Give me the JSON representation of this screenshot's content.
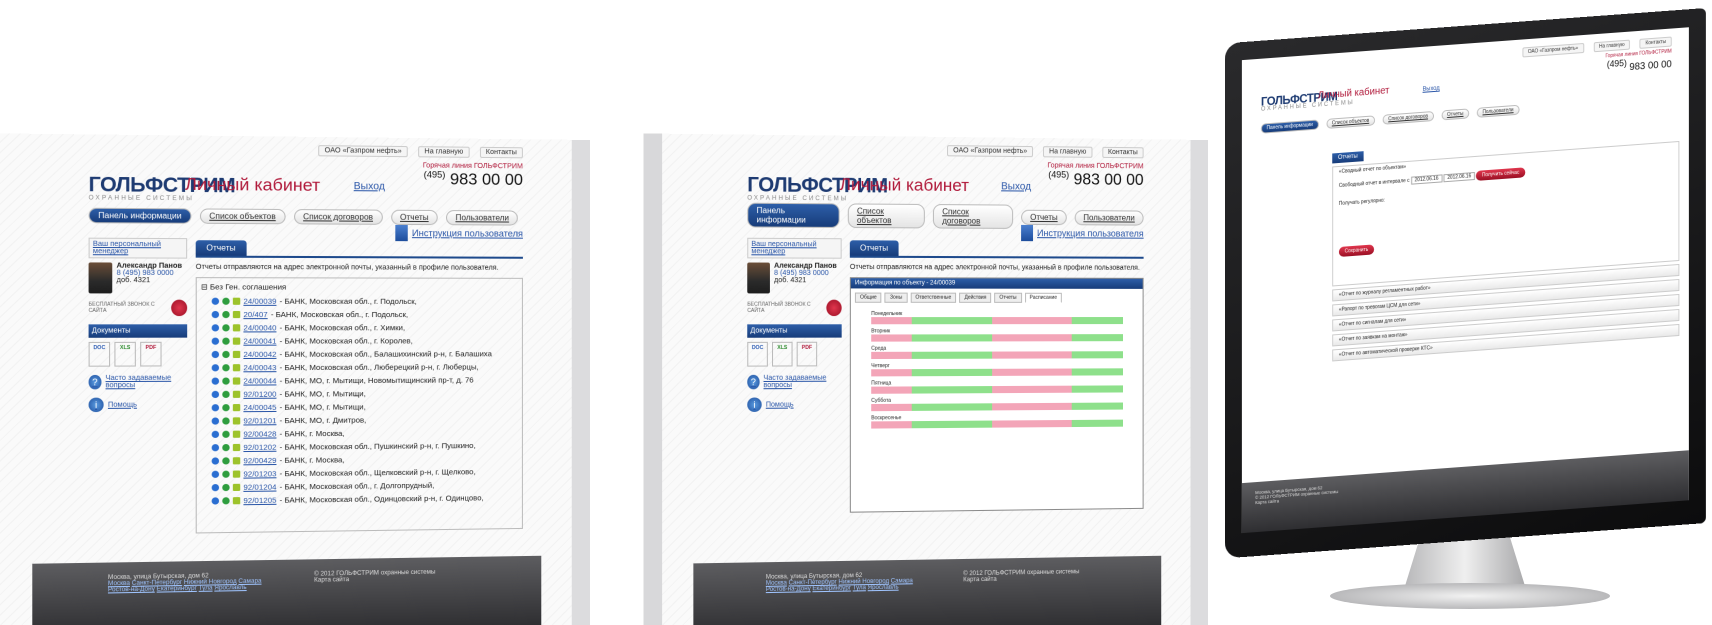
{
  "site": {
    "logo_main": "ГОЛЬФСТРИМ",
    "logo_sub": "ОХРАННЫЕ СИСТЕМЫ",
    "cabinet_title": "Личный кабинет",
    "exit_label": "Выход",
    "top_links": [
      "ОАО «Газпром нефть»",
      "На главную",
      "Контакты"
    ],
    "hotline_label": "Горячая линия ГОЛЬФСТРИМ",
    "phone_code": "(495)",
    "phone_number": "983 00 00",
    "nav_tabs": [
      "Панель информации",
      "Список объектов",
      "Список договоров",
      "Отчеты",
      "Пользователи"
    ],
    "instruction_label": "Инструкция пользователя",
    "manager_header": "Ваш персональный менеджер",
    "manager_name": "Александр Панов",
    "manager_phone": "8 (495) 983 0000",
    "manager_ext": "доб. 4321",
    "call_label": "БЕСПЛАТНЫЙ ЗВОНОК С САЙТА",
    "docs_header": "Документы",
    "doc_types": [
      "DOC",
      "XLS",
      "PDF"
    ],
    "faq_label": "Часто задаваемые вопросы",
    "help_label": "Помощь",
    "reports_tab": "Отчеты",
    "reports_note": "Отчеты отправляются на адрес электронной почты, указанный в профиле пользователя.",
    "footer_address": "Москва, улица Бутырская, дом 62",
    "footer_cities_1": [
      "Москва",
      "Санкт-Петербург",
      "Нижний Новгород",
      "Самара"
    ],
    "footer_cities_2": [
      "Ростов-на-Дону",
      "Екатеринбург",
      "Тула",
      "Ярославль"
    ],
    "footer_copyright": "© 2012 ГОЛЬФСТРИМ охранные системы",
    "footer_sitemap": "Карта сайта"
  },
  "tree": {
    "root": "Без Ген. соглашения",
    "rows": [
      {
        "code": "24/00039",
        "text": " - БАНК, Московская обл., г. Подольск,"
      },
      {
        "code": "20/407",
        "text": " - БАНК, Московская обл., г. Подольск,"
      },
      {
        "code": "24/00040",
        "text": " - БАНК, Московская обл., г. Химки,"
      },
      {
        "code": "24/00041",
        "text": " - БАНК, Московская обл., г. Королев,"
      },
      {
        "code": "24/00042",
        "text": " - БАНК, Московская обл., Балашихинский р-н, г. Балашиха"
      },
      {
        "code": "24/00043",
        "text": " - БАНК, Московская обл., Люберецкий р-н, г. Люберцы,"
      },
      {
        "code": "24/00044",
        "text": " - БАНК, МО, г. Мытищи, Новомытищинский пр-т, д. 76"
      },
      {
        "code": "92/01200",
        "text": " - БАНК, МО, г. Мытищи,"
      },
      {
        "code": "24/00045",
        "text": " - БАНК, МО, г. Мытищи,"
      },
      {
        "code": "92/01201",
        "text": " - БАНК, МО, г. Дмитров,"
      },
      {
        "code": "92/00428",
        "text": " - БАНК, г. Москва,"
      },
      {
        "code": "92/01202",
        "text": " - БАНК, Московская обл., Пушкинский р-н, г. Пушкино,"
      },
      {
        "code": "92/00429",
        "text": " - БАНК, г. Москва,"
      },
      {
        "code": "92/01203",
        "text": " - БАНК, Московская обл., Щелковский р-н, г. Щелково,"
      },
      {
        "code": "92/01204",
        "text": " - БАНК, Московская обл., г. Долгопрудный,"
      },
      {
        "code": "92/01205",
        "text": " - БАНК, Московская обл., Одинцовский р-н, г. Одинцово,"
      }
    ]
  },
  "popup": {
    "title": "Информация по объекту - 24/00039",
    "tabs": [
      "Общие",
      "Зоны",
      "Ответственные",
      "Действия",
      "Отчеты",
      "Расписание"
    ],
    "days": [
      "Понедельник",
      "Вторник",
      "Среда",
      "Четверг",
      "Пятница",
      "Суббота",
      "Воскресенье"
    ]
  },
  "monitor": {
    "report_header": "«Сводный отчет по объектам»",
    "interval_label": "Свободный отчет в интервале с",
    "date_from": "2012.06.16",
    "date_to": "2012.06.16",
    "get_now": "Получить сейчас",
    "regular_label": "Получать регулярно:",
    "save_label": "Сохранить",
    "sections": [
      "«Отчет по журналу регламентных работ»",
      "«Рапорт по тревогам ЦСМ для сети»",
      "«Отчет по сигналам для сети»",
      "«Отчет по заявкам на монтаж»",
      "«Отчет по автоматической проверке КТС»"
    ]
  }
}
